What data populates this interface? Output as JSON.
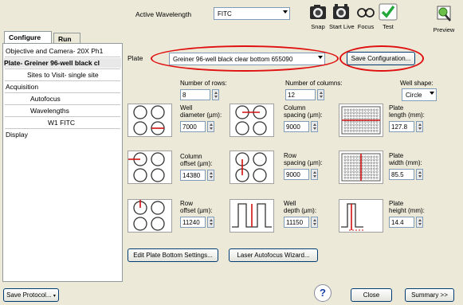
{
  "toolbar": {
    "active_wavelength_label": "Active Wavelength",
    "active_wavelength_value": "FITC",
    "buttons": [
      {
        "label": "Snap",
        "icon": "camera-icon"
      },
      {
        "label": "Start Live",
        "icon": "live-camera-icon"
      },
      {
        "label": "Focus",
        "icon": "focus-glasses-icon"
      },
      {
        "label": "Test",
        "icon": "checkmark-icon"
      },
      {
        "label": "Preview",
        "icon": "preview-icon"
      }
    ]
  },
  "tabs": [
    {
      "label": "Configure",
      "active": true
    },
    {
      "label": "Run",
      "active": false
    }
  ],
  "sidebar": {
    "items": [
      {
        "label": "Objective and Camera- 20X Ph1",
        "indent": 0,
        "selected": false
      },
      {
        "label": "Plate- Greiner 96-well black cl",
        "indent": 0,
        "selected": true
      },
      {
        "label": "Sites to Visit- single site",
        "indent": 2,
        "selected": false
      },
      {
        "label": "Acquisition",
        "indent": 0,
        "selected": false
      },
      {
        "label": "Autofocus",
        "indent": 2,
        "selected": false
      },
      {
        "label": "Wavelengths",
        "indent": 2,
        "selected": false
      },
      {
        "label": "W1 FITC",
        "indent": 3,
        "selected": false
      },
      {
        "label": "Display",
        "indent": 0,
        "selected": false
      }
    ]
  },
  "plate": {
    "label": "Plate",
    "selected": "Greiner 96-well black clear bottom 655090",
    "save_config_label": "Save Configuration...",
    "num_rows_label": "Number of rows:",
    "num_rows": "8",
    "num_cols_label": "Number of columns:",
    "num_cols": "12",
    "well_shape_label": "Well shape:",
    "well_shape": "Circle",
    "well_diameter_label_1": "Well",
    "well_diameter_label_2": "diameter (µm):",
    "well_diameter": "7000",
    "column_spacing_label_1": "Column",
    "column_spacing_label_2": "spacing (µm):",
    "column_spacing": "9000",
    "plate_length_label_1": "Plate",
    "plate_length_label_2": "length (mm):",
    "plate_length": "127.8",
    "column_offset_label_1": "Column",
    "column_offset_label_2": "offset (µm):",
    "column_offset": "14380",
    "row_spacing_label_1": "Row",
    "row_spacing_label_2": "spacing (µm):",
    "row_spacing": "9000",
    "plate_width_label_1": "Plate",
    "plate_width_label_2": "width (mm):",
    "plate_width": "85.5",
    "row_offset_label_1": "Row",
    "row_offset_label_2": "offset (µm):",
    "row_offset": "11240",
    "well_depth_label_1": "Well",
    "well_depth_label_2": "depth (µm):",
    "well_depth": "11150",
    "plate_height_label_1": "Plate",
    "plate_height_label_2": "height (mm):",
    "plate_height": "14.4",
    "edit_bottom_label": "Edit Plate Bottom Settings...",
    "laser_af_label": "Laser Autofocus Wizard..."
  },
  "bottom": {
    "save_protocol_label": "Save Protocol...",
    "help_icon": "help-question-icon",
    "close_label": "Close",
    "summary_label": "Summary >>"
  },
  "colors": {
    "highlight": "#e01010",
    "selected_bg": "#e8e8e8",
    "window_bg": "#ece9d8"
  }
}
